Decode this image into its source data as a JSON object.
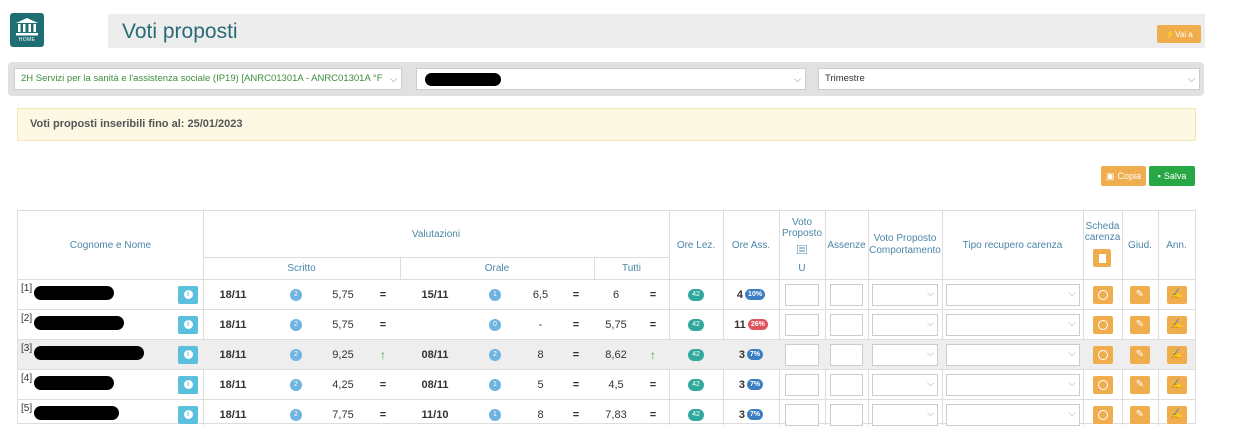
{
  "header": {
    "home_label": "HOME",
    "title": "Voti proposti",
    "vai_label": "Vai a"
  },
  "filters": {
    "class_value": "2H Servizi per la sanità e l'assistenza sociale (IP19) [ANRC01301A - ANRC01301A °F",
    "period_value": "Trimestre"
  },
  "alert": {
    "text": "Voti proposti inseribili fino al: 25/01/2023"
  },
  "actions": {
    "copia": "Copia",
    "salva": "Salva"
  },
  "columns": {
    "name": "Cognome e Nome",
    "valutazioni": "Valutazioni",
    "scritto": "Scritto",
    "orale": "Orale",
    "tutti": "Tutti",
    "ore_lez": "Ore Lez.",
    "ore_ass": "Ore Ass.",
    "voto_proposto": "Voto Proposto",
    "voto_u": "U",
    "assenze": "Assenze",
    "voto_comp": "Voto Proposto Comportamento",
    "tipo_recupero": "Tipo recupero carenza",
    "scheda": "Scheda carenza",
    "giud": "Giud.",
    "ann": "Ann."
  },
  "rows": [
    {
      "idx": "[1]",
      "s_date": "18/11",
      "s_count": "2",
      "s_avg": "5,75",
      "s_trend": "=",
      "o_date": "15/11",
      "o_count": "1",
      "o_avg": "6,5",
      "o_trend": "=",
      "t_avg": "6",
      "t_trend": "=",
      "ore_lez": "42",
      "ore_ass": "4",
      "ass_pct": "10%",
      "pct_color": "blue"
    },
    {
      "idx": "[2]",
      "s_date": "18/11",
      "s_count": "2",
      "s_avg": "5,75",
      "s_trend": "=",
      "o_date": "",
      "o_count": "0",
      "o_avg": "-",
      "o_trend": "=",
      "t_avg": "5,75",
      "t_trend": "=",
      "ore_lez": "42",
      "ore_ass": "11",
      "ass_pct": "26%",
      "pct_color": "red"
    },
    {
      "idx": "[3]",
      "s_date": "18/11",
      "s_count": "2",
      "s_avg": "9,25",
      "s_trend": "↑",
      "o_date": "08/11",
      "o_count": "2",
      "o_avg": "8",
      "o_trend": "=",
      "t_avg": "8,62",
      "t_trend": "↑",
      "ore_lez": "42",
      "ore_ass": "3",
      "ass_pct": "7%",
      "pct_color": "blue"
    },
    {
      "idx": "[4]",
      "s_date": "18/11",
      "s_count": "2",
      "s_avg": "4,25",
      "s_trend": "=",
      "o_date": "08/11",
      "o_count": "1",
      "o_avg": "5",
      "o_trend": "=",
      "t_avg": "4,5",
      "t_trend": "=",
      "ore_lez": "42",
      "ore_ass": "3",
      "ass_pct": "7%",
      "pct_color": "blue"
    },
    {
      "idx": "[5]",
      "s_date": "18/11",
      "s_count": "2",
      "s_avg": "7,75",
      "s_trend": "=",
      "o_date": "11/10",
      "o_count": "1",
      "o_avg": "8",
      "o_trend": "=",
      "t_avg": "7,83",
      "t_trend": "=",
      "ore_lez": "42",
      "ore_ass": "3",
      "ass_pct": "7%",
      "pct_color": "blue"
    }
  ],
  "colors": {
    "accent_yellow": "#f0ad4e",
    "accent_green": "#28a745",
    "info_blue": "#5bc0de",
    "title": "#2a6b78"
  }
}
